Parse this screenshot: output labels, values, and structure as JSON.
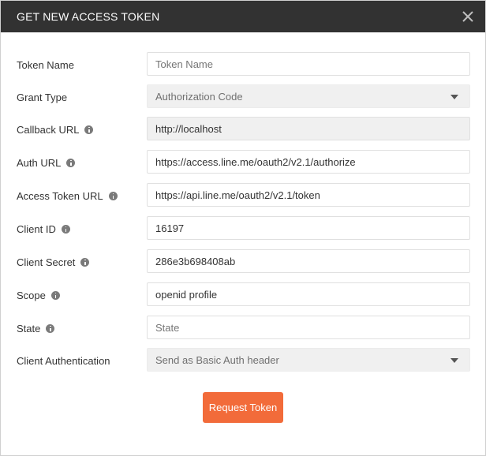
{
  "dialog": {
    "title": "GET NEW ACCESS TOKEN",
    "close_icon": "close-icon"
  },
  "form": {
    "token_name": {
      "label": "Token Name",
      "value": "",
      "placeholder": "Token Name"
    },
    "grant_type": {
      "label": "Grant Type",
      "selected": "Authorization Code"
    },
    "callback_url": {
      "label": "Callback URL",
      "value": "http://localhost"
    },
    "auth_url": {
      "label": "Auth URL",
      "value": "https://access.line.me/oauth2/v2.1/authorize"
    },
    "access_token_url": {
      "label": "Access Token URL",
      "value": "https://api.line.me/oauth2/v2.1/token"
    },
    "client_id": {
      "label": "Client ID",
      "value_visible": "16197"
    },
    "client_secret": {
      "label": "Client Secret",
      "value_visible": "286e3b698408ab"
    },
    "scope": {
      "label": "Scope",
      "value": "openid profile"
    },
    "state": {
      "label": "State",
      "value": "",
      "placeholder": "State"
    },
    "client_authentication": {
      "label": "Client Authentication",
      "selected": "Send as Basic Auth header"
    }
  },
  "actions": {
    "request_token_label": "Request Token"
  },
  "colors": {
    "header_bg": "#323232",
    "accent": "#f26b3a"
  }
}
